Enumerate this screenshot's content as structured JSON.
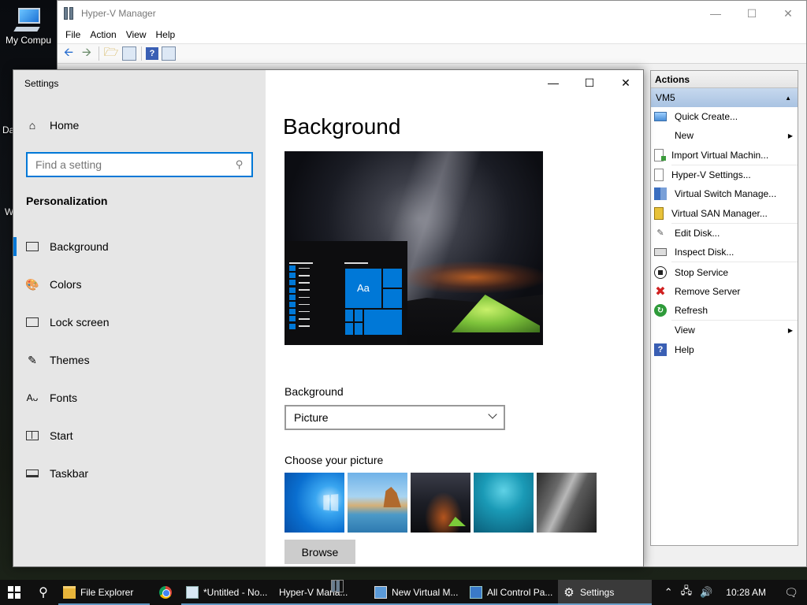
{
  "desktop": {
    "icon_label": "My Compu",
    "fragment1": "Da",
    "fragment2": "W"
  },
  "hyperv": {
    "title": "Hyper-V Manager",
    "menu": [
      "File",
      "Action",
      "View",
      "Help"
    ],
    "actions_header": "Actions",
    "group": "VM5",
    "actions": [
      {
        "label": "Quick Create...",
        "icon": "monitor-icon"
      },
      {
        "label": "New",
        "icon": "none",
        "submenu": true
      },
      {
        "label": "Import Virtual Machin...",
        "icon": "import-icon"
      },
      {
        "label": "Hyper-V Settings...",
        "icon": "document-icon"
      },
      {
        "label": "Virtual Switch Manage...",
        "icon": "switch-icon"
      },
      {
        "label": "Virtual SAN Manager...",
        "icon": "san-icon"
      },
      {
        "label": "Edit Disk...",
        "icon": "pencil-icon"
      },
      {
        "label": "Inspect Disk...",
        "icon": "disk-icon"
      },
      {
        "label": "Stop Service",
        "icon": "stop-icon"
      },
      {
        "label": "Remove Server",
        "icon": "remove-icon"
      },
      {
        "label": "Refresh",
        "icon": "refresh-icon"
      },
      {
        "label": "View",
        "icon": "none",
        "submenu": true
      },
      {
        "label": "Help",
        "icon": "help-icon"
      }
    ]
  },
  "settings": {
    "title": "Settings",
    "home": "Home",
    "search_placeholder": "Find a setting",
    "section": "Personalization",
    "nav": [
      {
        "label": "Background",
        "icon": "image-icon",
        "active": true
      },
      {
        "label": "Colors",
        "icon": "palette-icon"
      },
      {
        "label": "Lock screen",
        "icon": "lock-screen-icon"
      },
      {
        "label": "Themes",
        "icon": "themes-icon"
      },
      {
        "label": "Fonts",
        "icon": "fonts-icon"
      },
      {
        "label": "Start",
        "icon": "start-icon"
      },
      {
        "label": "Taskbar",
        "icon": "taskbar-icon"
      }
    ],
    "page_title": "Background",
    "preview_tile_text": "Aa",
    "background_label": "Background",
    "background_value": "Picture",
    "choose_label": "Choose your picture",
    "browse": "Browse"
  },
  "taskbar": {
    "items": [
      {
        "label": "File Explorer",
        "icon": "folder-icon"
      },
      {
        "label": "",
        "icon": "chrome-icon"
      },
      {
        "label": "*Untitled - No...",
        "icon": "notepad-icon"
      },
      {
        "label": "Hyper-V Mana...",
        "icon": "hyperv-icon"
      },
      {
        "label": "New Virtual M...",
        "icon": "vm-icon"
      },
      {
        "label": "All Control Pa...",
        "icon": "control-panel-icon"
      },
      {
        "label": "Settings",
        "icon": "gear-icon",
        "active": true
      }
    ],
    "time": "10:28 AM"
  },
  "colors": {
    "accent": "#0078d7",
    "taskbar": "#101010",
    "actions_group": "#b8cfea"
  }
}
